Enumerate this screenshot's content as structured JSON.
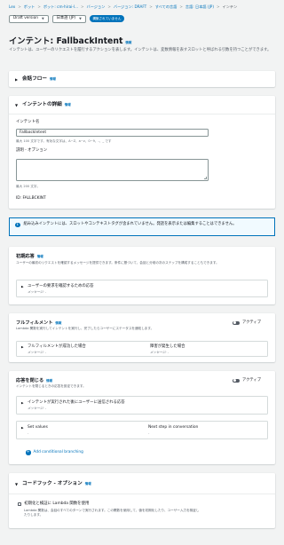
{
  "breadcrumb": [
    {
      "label": "Lex",
      "link": true
    },
    {
      "label": "ボット",
      "link": true
    },
    {
      "label": "ボット: cm-hirai-l...",
      "link": true
    },
    {
      "label": "バージョン",
      "link": true
    },
    {
      "label": "バージョン: DRAFT",
      "link": true
    },
    {
      "label": "すべての言語",
      "link": true
    },
    {
      "label": "言語: 日本語 (JP)",
      "link": true
    },
    {
      "label": "インテン",
      "link": false
    }
  ],
  "toolbar": {
    "version_select": "Draft version",
    "language_select": "日本語 (JP)",
    "status_badge": "構築されていません"
  },
  "page": {
    "title": "インテント: FallbackIntent",
    "info": "情報",
    "description": "インテントは、ユーザーのリクエストを履行するアクションを表します。インテントは、変数情報を表すスロットと呼ばれる引数を持つことができます。"
  },
  "conversation_flow": {
    "title": "会話フロー",
    "info": "情報"
  },
  "intent_details": {
    "title": "インテントの詳細",
    "info": "情報",
    "name_label": "インテント名",
    "name_value": "FallbackIntent",
    "name_hint": "最大 100 文字です。有効な文字は、A~Z、a~z、0~9、-、_ です",
    "desc_label": "説明 - オプション",
    "desc_hint": "最大 200 文字。",
    "id_text": "ID: FALLBCKINT"
  },
  "alert": {
    "icon": "info-icon",
    "text": "組み込みインテントには、スロットやコンテキストタグが含まれていません。発話を表示または編集することはできません。"
  },
  "initial_response": {
    "title": "初期応答",
    "info": "情報",
    "description": "ユーザーの最初のリクエストを確認するメッセージを提供できます。条件に基づいて、会話と分岐の次のステップを構成することもできます。",
    "sub_title": "ユーザーの要求を確認するための応答",
    "sub_msg": "メッセージ: -"
  },
  "fulfillment": {
    "title": "フルフィルメント",
    "info": "情報",
    "toggle_label": "アクティブ",
    "description": "Lambda 関数を実行してインテントを実行し、完了したらユーザーにステータスを通知します。",
    "success_title": "フルフィルメントが成功した場合",
    "success_msg": "メッセージ: -",
    "failure_title": "障害が発生した場合",
    "failure_msg": "メッセージ: -"
  },
  "closing_response": {
    "title": "応答を閉じる",
    "info": "情報",
    "toggle_label": "アクティブ",
    "description": "インテントを閉じるときの応答を設定できます。",
    "sub_title": "インテントが実行された後にユーザーに送信される応答",
    "sub_msg": "メッセージ: -",
    "set_values": "Set values",
    "next_step": "Next step in conversation",
    "dash1": "-",
    "dash2": "-",
    "add_branching": "Add conditional branching"
  },
  "code_hooks": {
    "title": "コードフック - オプション",
    "info": "情報",
    "checkbox_label": "初期化と検証に Lambda 関数を使用",
    "checkbox_desc": "Lambda 関数は、会話のすべてのターンで実行されます。この関数を使用して、値を初期化したり、ユーザー入力を検証したりします。"
  }
}
